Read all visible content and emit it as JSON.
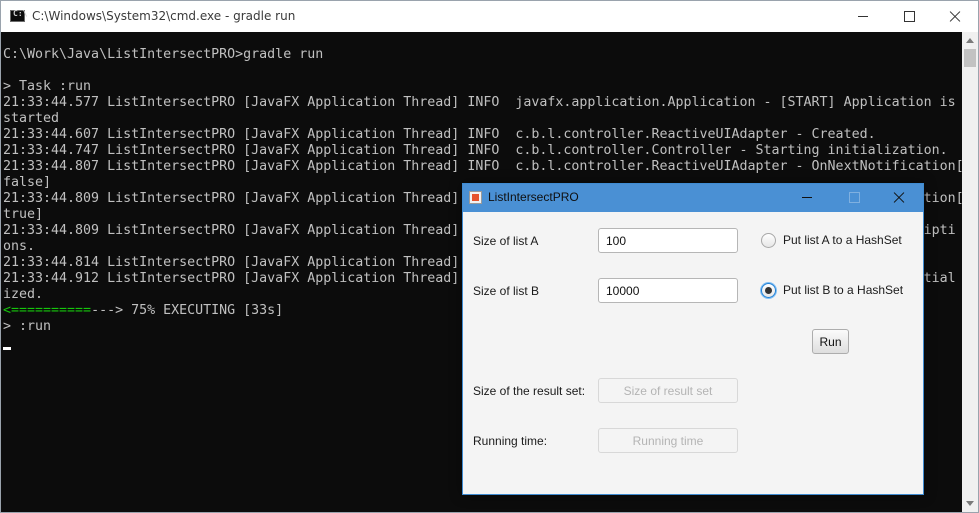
{
  "cmd": {
    "title": "C:\\Windows\\System32\\cmd.exe - gradle  run",
    "icon_text": "C:\\",
    "lines": [
      "C:\\Work\\Java\\ListIntersectPRO>gradle run",
      "",
      "> Task :run",
      "21:33:44.577 ListIntersectPRO [JavaFX Application Thread] INFO  javafx.application.Application - [START] Application is",
      "started",
      "21:33:44.607 ListIntersectPRO [JavaFX Application Thread] INFO  c.b.l.controller.ReactiveUIAdapter - Created.",
      "21:33:44.747 ListIntersectPRO [JavaFX Application Thread] INFO  c.b.l.controller.Controller - Starting initialization.",
      "21:33:44.807 ListIntersectPRO [JavaFX Application Thread] INFO  c.b.l.controller.ReactiveUIAdapter - OnNextNotification[",
      "false]",
      "21:33:44.809 ListIntersectPRO [JavaFX Application Thread]                                                         ation[",
      "true]",
      "21:33:44.809 ListIntersectPRO [JavaFX Application Thread]                                                         ripti",
      "ons.",
      "21:33:44.814 ListIntersectPRO [JavaFX Application Thread]",
      "21:33:44.912 ListIntersectPRO [JavaFX Application Thread]                                                         itial",
      "ized."
    ],
    "progress": {
      "bar_done": "<==========",
      "bar_rest": "---> 75% EXECUTING [33s]",
      "percent": 75
    },
    "task_line": "> :run"
  },
  "fx": {
    "title": "ListIntersectPRO",
    "size_a_label": "Size of list A",
    "size_a_value": "100",
    "size_b_label": "Size of list B",
    "size_b_value": "10000",
    "radio_a_label": "Put list A to a HashSet",
    "radio_b_label": "Put list B to a HashSet",
    "radio_a_selected": false,
    "radio_b_selected": true,
    "run_label": "Run",
    "result_label": "Size of the result set:",
    "result_placeholder": "Size of result set",
    "time_label": "Running time:",
    "time_placeholder": "Running time"
  }
}
